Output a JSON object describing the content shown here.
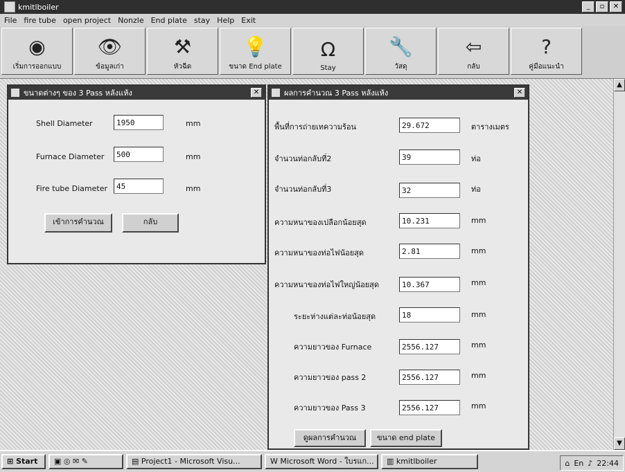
{
  "app": {
    "title": "kmitlboiler"
  },
  "menu": [
    "File",
    "fire tube",
    "open project",
    "Nonzle",
    "End plate",
    "stay",
    "Help",
    "Exit"
  ],
  "toolbar": [
    {
      "label": "เริ่มการออกแบบ",
      "icon": "target-icon",
      "glyph": "◉"
    },
    {
      "label": "ข้อมูลเก่า",
      "icon": "eye-icon",
      "glyph": "👁"
    },
    {
      "label": "หัวฉีด",
      "icon": "nozzle-icon",
      "glyph": "⚒"
    },
    {
      "label": "ขนาด End plate",
      "icon": "lightbulb-icon",
      "glyph": "💡"
    },
    {
      "label": "Stay",
      "icon": "magnet-icon",
      "glyph": "Ω"
    },
    {
      "label": "วัสดุ",
      "icon": "wrench-icon",
      "glyph": "🔧"
    },
    {
      "label": "กลับ",
      "icon": "back-arrow-icon",
      "glyph": "⇦"
    },
    {
      "label": "คู่มือแนะนำ",
      "icon": "help-icon",
      "glyph": "?"
    }
  ],
  "input_window": {
    "title": "ขนาดต่างๆ ของ 3 Pass หลังแห้ง",
    "fields": [
      {
        "label": "Shell Diameter",
        "value": "1950",
        "unit": "mm"
      },
      {
        "label": "Furnace Diameter",
        "value": "500",
        "unit": "mm"
      },
      {
        "label": "Fire tube Diameter",
        "value": "45",
        "unit": "mm"
      }
    ],
    "calc_button": "เข้าการคำนวณ",
    "back_button": "กลับ"
  },
  "result_window": {
    "title": "ผลการคำนวณ 3 Pass หลังแห้ง",
    "rows": [
      {
        "label": "พื้นที่การถ่ายเทความร้อน",
        "value": "29.672",
        "unit": "ตารางเมตร"
      },
      {
        "label": "จำนวนท่อกลับที่2",
        "value": "39",
        "unit": "ท่อ"
      },
      {
        "label": "จำนวนท่อกลับที่3",
        "value": "32",
        "unit": "ท่อ"
      },
      {
        "label": "ความหนาของเปลือกน้อยสุด",
        "value": "10.231",
        "unit": "mm"
      },
      {
        "label": "ความหนาของท่อไฟน้อยสุด",
        "value": "2.81",
        "unit": "mm"
      },
      {
        "label": "ความหนาของท่อไฟใหญ่น้อยสุด",
        "value": "10.367",
        "unit": "mm"
      },
      {
        "label": "ระยะห่างแต่ละท่อน้อยสุด",
        "value": "18",
        "unit": "mm"
      },
      {
        "label": "ความยาวของ Furnace",
        "value": "2556.127",
        "unit": "mm"
      },
      {
        "label": "ความยาวของ pass 2",
        "value": "2556.127",
        "unit": "mm"
      },
      {
        "label": "ความยาวของ Pass 3",
        "value": "2556.127",
        "unit": "mm"
      }
    ],
    "calc_button": "ดูผลการคำนวณ",
    "endplate_button": "ขนาด end plate"
  },
  "taskbar": {
    "start": "Start",
    "items": [
      "Project1 - Microsoft Visu...",
      "Microsoft Word - ใบรแก...",
      "kmitlboiler"
    ],
    "clock": "22:44",
    "lang": "En"
  }
}
